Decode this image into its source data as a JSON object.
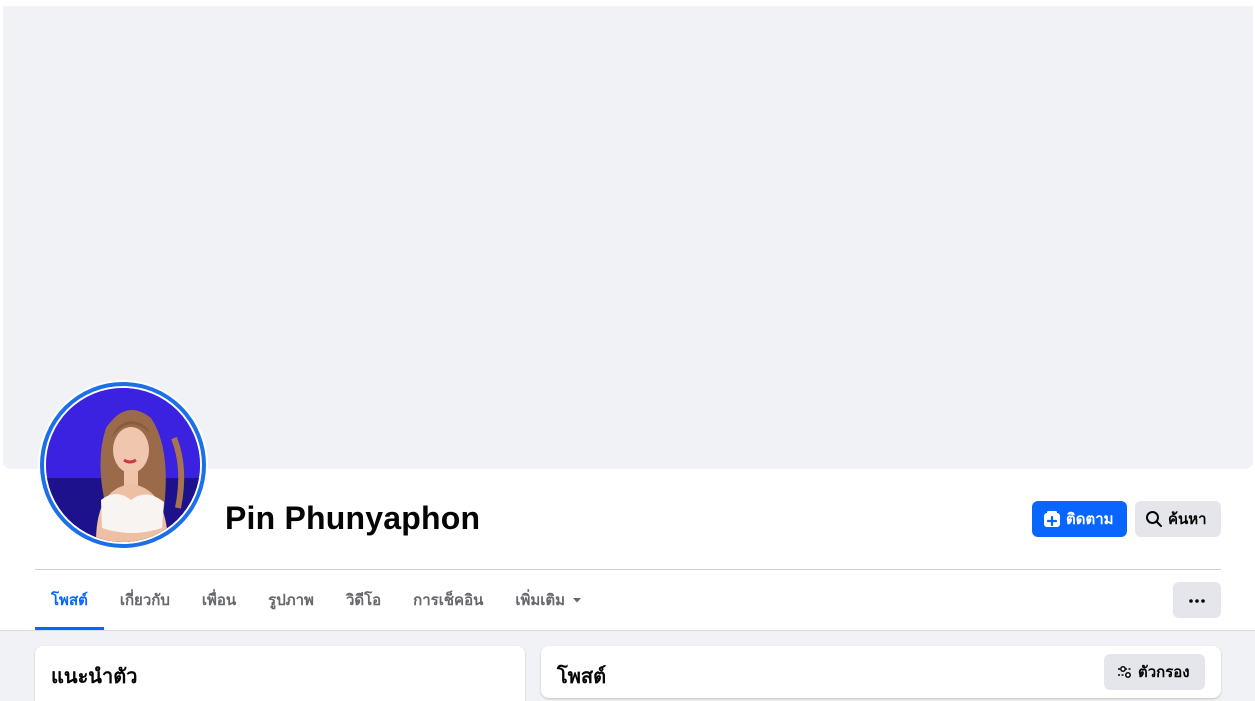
{
  "profile": {
    "name": "Pin Phunyaphon",
    "follow_label": "ติดตาม",
    "search_label": "ค้นหา"
  },
  "tabs": [
    {
      "label": "โพสต์",
      "active": true
    },
    {
      "label": "เกี่ยวกับ",
      "active": false
    },
    {
      "label": "เพื่อน",
      "active": false
    },
    {
      "label": "รูปภาพ",
      "active": false
    },
    {
      "label": "วิดีโอ",
      "active": false
    },
    {
      "label": "การเช็คอิน",
      "active": false
    },
    {
      "label": "เพิ่มเติม",
      "active": false
    }
  ],
  "intro": {
    "title": "แนะนำตัว"
  },
  "posts": {
    "title": "โพสต์",
    "filter_label": "ตัวกรอง"
  },
  "colors": {
    "accent": "#0866ff",
    "avatar_ring": "#1b6fe8",
    "button_grey": "#e4e6eb",
    "background": "#f0f2f5"
  },
  "icons": {
    "follow": "follow-plus-icon",
    "search": "search-icon",
    "more": "more-dots-icon",
    "caret": "caret-down-icon",
    "filter": "filter-sliders-icon"
  }
}
